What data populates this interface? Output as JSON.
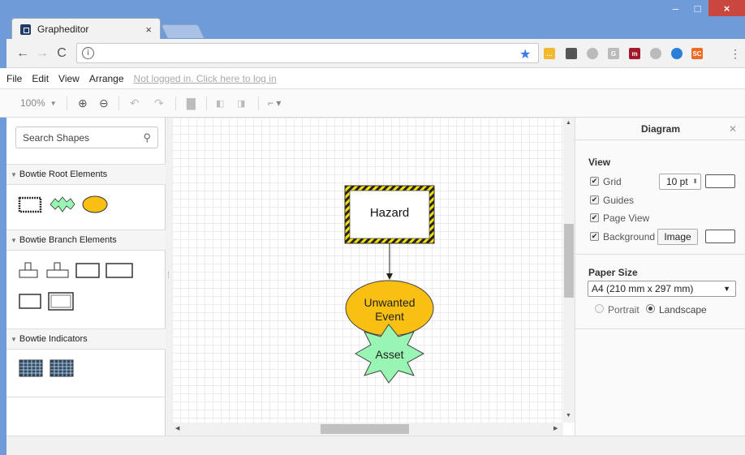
{
  "browser": {
    "tab_title": "Grapheditor",
    "url_text": "",
    "window_controls": [
      "minimize-icon",
      "maximize-icon",
      "close-icon"
    ]
  },
  "menu": {
    "items": [
      "File",
      "Edit",
      "View",
      "Arrange"
    ],
    "login_text": "Not logged in. Click here to log in"
  },
  "toolbar": {
    "zoom": "100%"
  },
  "sidebar": {
    "search_placeholder": "Search Shapes",
    "sections": [
      {
        "title": "Bowtie Root Elements",
        "shapes": [
          "Hazard",
          "Asset",
          "Unwanted Event"
        ]
      },
      {
        "title": "Bowtie Branch Elements",
        "shapes": [
          "Barrier",
          "Security Control",
          "Threat",
          "Consequence",
          "Cause",
          "Escalation Factor"
        ]
      },
      {
        "title": "Bowtie Indicators",
        "shapes": [
          "Indicator table",
          "Indicator table"
        ]
      }
    ]
  },
  "diagram": {
    "hazard_label": "Hazard",
    "unwanted_event_label": "Unwanted\nEvent",
    "asset_label": "Asset",
    "colors": {
      "event_fill": "#f8c012",
      "asset_fill": "#98f5b2",
      "hazard_border": "#2b2b2b"
    }
  },
  "format_panel": {
    "title": "Diagram",
    "view_heading": "View",
    "grid_label": "Grid",
    "grid_size": "10 pt",
    "guides_label": "Guides",
    "page_view_label": "Page View",
    "background_label": "Background",
    "image_button": "Image",
    "paper_size_heading": "Paper Size",
    "paper_size_value": "A4 (210 mm x 297 mm)",
    "portrait_label": "Portrait",
    "landscape_label": "Landscape"
  }
}
